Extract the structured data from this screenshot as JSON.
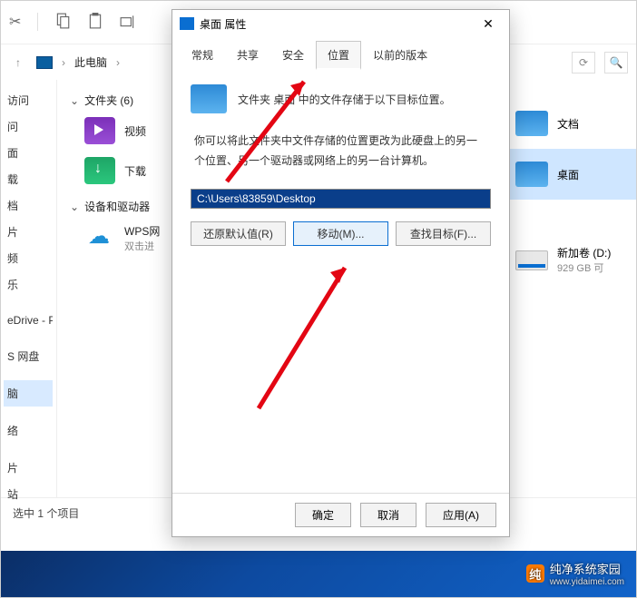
{
  "toolbar": {},
  "breadcrumb": {
    "location": "此电脑"
  },
  "sidebar": {
    "items": [
      {
        "label": "问"
      },
      {
        "label": "面"
      },
      {
        "label": "载"
      },
      {
        "label": "档"
      },
      {
        "label": "片"
      },
      {
        "label": "频"
      },
      {
        "label": "乐"
      },
      {
        "label": ""
      },
      {
        "label": "eDrive - Pers"
      },
      {
        "label": ""
      },
      {
        "label": "S 网盘"
      },
      {
        "label": ""
      },
      {
        "label": "脑"
      },
      {
        "label": ""
      },
      {
        "label": "络"
      },
      {
        "label": ""
      },
      {
        "label": "片"
      },
      {
        "label": "站"
      }
    ]
  },
  "sections": {
    "folders_header": "文件夹 (6)",
    "devices_header": "设备和驱动器",
    "video_label": "视频",
    "download_label": "下载",
    "wps_label": "WPS网",
    "wps_sub": "双击进"
  },
  "sidebar_top_item": "访问",
  "rightpane": {
    "docs": "文档",
    "desktop": "桌面",
    "drive_name": "新加卷 (D:)",
    "drive_free": "929 GB 可"
  },
  "statusbar": {
    "text": "选中 1 个项目"
  },
  "dialog": {
    "title": "桌面 属性",
    "tabs": [
      "常规",
      "共享",
      "安全",
      "位置",
      "以前的版本"
    ],
    "intro": "文件夹 桌面 中的文件存储于以下目标位置。",
    "desc": "你可以将此文件夹中文件存储的位置更改为此硬盘上的另一个位置、另一个驱动器或网络上的另一台计算机。",
    "path": "C:\\Users\\83859\\Desktop",
    "restore": "还原默认值(R)",
    "move": "移动(M)...",
    "find": "查找目标(F)...",
    "ok": "确定",
    "cancel": "取消",
    "apply": "应用(A)"
  },
  "watermark": {
    "brand": "纯净系统家园",
    "domain": "www.yidaimei.com"
  }
}
